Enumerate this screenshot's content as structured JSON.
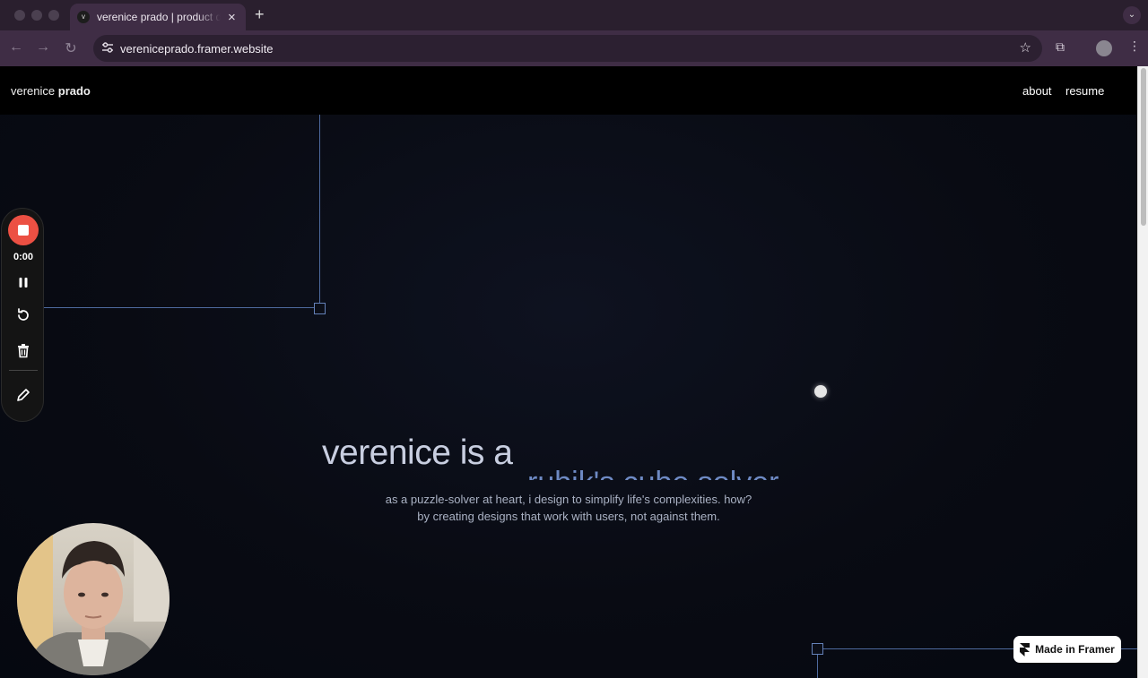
{
  "browser": {
    "tab_title": "verenice prado | product designer",
    "tab_favicon_letter": "v",
    "url": "vereniceprado.framer.website",
    "icons": [
      "close-icon",
      "plus-icon",
      "back-icon",
      "forward-icon",
      "reload-icon",
      "site-settings-icon",
      "bookmark-star-icon",
      "extensions-icon",
      "profile-avatar-icon",
      "more-menu-icon",
      "tab-search-icon"
    ]
  },
  "site": {
    "brand_first": "verenice",
    "brand_last": "prado",
    "nav": [
      {
        "label": "about"
      },
      {
        "label": "resume"
      }
    ]
  },
  "hero": {
    "headline": "verenice is a",
    "role": "rubik's cube solver",
    "subtitle_line1": "as a puzzle-solver at heart, i design to simplify life's complexities. how?",
    "subtitle_line2": "by creating designs that work with users, not against them."
  },
  "badge": {
    "label": "Made in Framer"
  },
  "recorder": {
    "time": "0:00",
    "icons": [
      "stop-record-icon",
      "pause-icon",
      "restart-icon",
      "trash-icon",
      "pencil-icon"
    ]
  },
  "colors": {
    "accent_line": "#4e6a9e",
    "role_text": "#6e8ac4",
    "record_red": "#ec5043",
    "browser_frame": "#3f2d45"
  }
}
